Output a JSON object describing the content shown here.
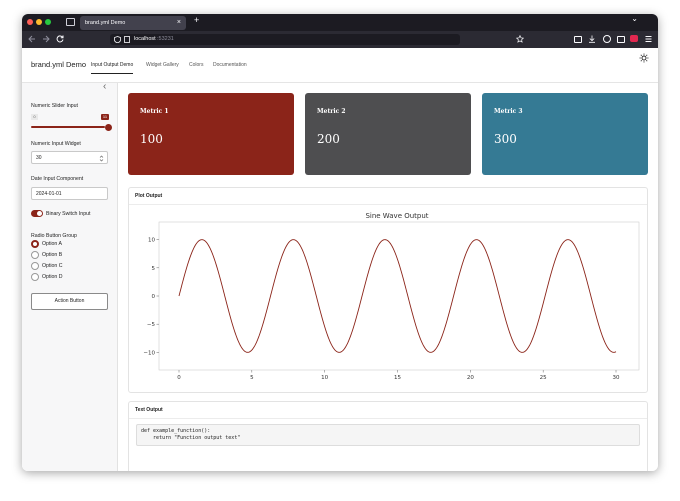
{
  "browser": {
    "tab_title": "brand.yml Demo",
    "tab_close": "×",
    "new_tab": "+",
    "url_host": "localhost",
    "url_port": ":53231",
    "menu_chevron": "⌄"
  },
  "app": {
    "brand": "brand.yml Demo",
    "nav_tabs": [
      "Input Output Demo",
      "Widget Gallery",
      "Colors",
      "Documentation"
    ],
    "active_tab_index": 0
  },
  "sidebar": {
    "collapse_glyph": "‹",
    "slider": {
      "label": "Numeric Slider Input",
      "min_label": "0",
      "value_label": "11",
      "value_fraction": 1.0
    },
    "numeric_input": {
      "label": "Numeric Input Widget",
      "value": "30"
    },
    "date_input": {
      "label": "Date Input Component",
      "value": "2024-01-01"
    },
    "switch": {
      "label": "Binary Switch Input",
      "on": true
    },
    "radio": {
      "label": "Radio Button Group",
      "options": [
        "Option A",
        "Option B",
        "Option C",
        "Option D"
      ],
      "selected_index": 0
    },
    "action_button": "Action Button"
  },
  "metrics": [
    {
      "title": "Metric 1",
      "value": "100",
      "color": "#8b2419"
    },
    {
      "title": "Metric 2",
      "value": "200",
      "color": "#4e4e50"
    },
    {
      "title": "Metric 3",
      "value": "300",
      "color": "#357a94"
    }
  ],
  "plot_card": {
    "header": "Plot Output"
  },
  "text_card": {
    "header": "Text Output",
    "code_line1": "def example_function():",
    "code_line2": "    return \"Function output text\""
  },
  "chart_data": {
    "type": "line",
    "title": "Sine Wave Output",
    "xlabel": "",
    "ylabel": "",
    "function": "10*sin(x)",
    "x_range": [
      0,
      30
    ],
    "xlim": [
      0,
      30
    ],
    "ylim": [
      -11,
      11
    ],
    "xticks": [
      0,
      5,
      10,
      15,
      20,
      25,
      30
    ],
    "yticks": [
      10,
      5,
      0,
      -5,
      -10
    ],
    "ytick_labels": [
      "10",
      "5",
      "0",
      "−5",
      "−10"
    ],
    "line_color": "#8b2419",
    "grid": false
  }
}
